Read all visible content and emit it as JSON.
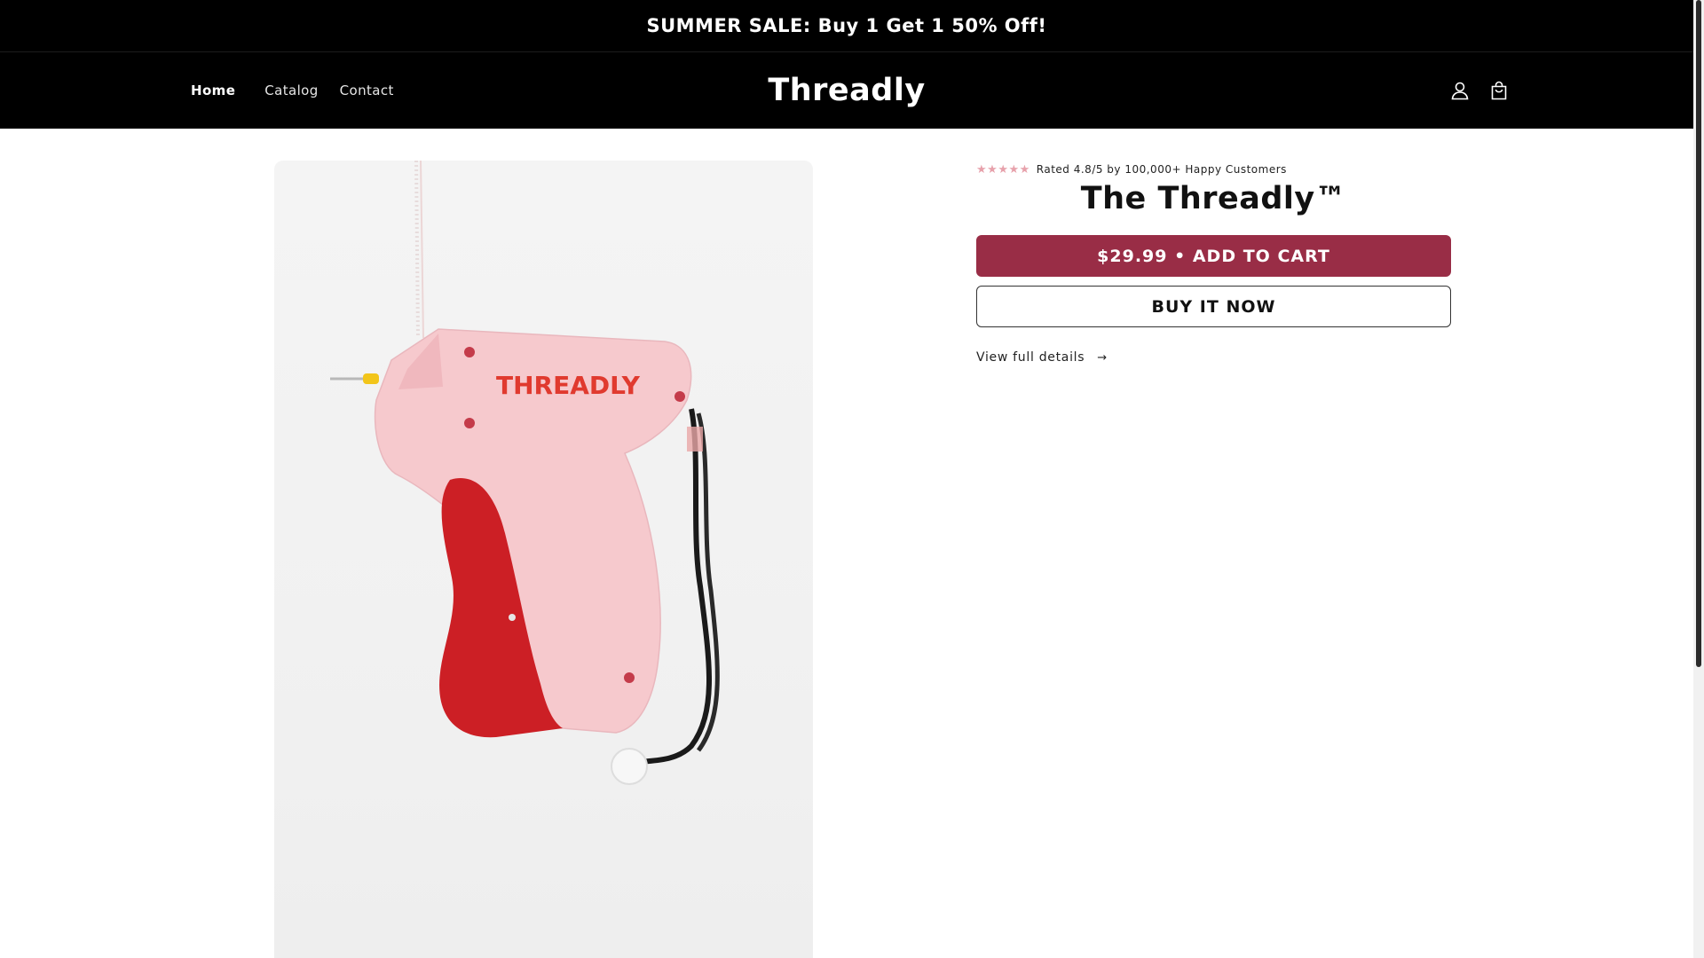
{
  "announcement": {
    "text": "SUMMER SALE: Buy 1 Get 1 50% Off!"
  },
  "header": {
    "nav": [
      {
        "label": "Home",
        "active": true
      },
      {
        "label": "Catalog",
        "active": false
      },
      {
        "label": "Contact",
        "active": false
      }
    ],
    "logo": "Threadly",
    "icons": [
      "account-icon",
      "cart-icon"
    ]
  },
  "product": {
    "image_brand_text": "THREADLY",
    "rating": {
      "stars": 5,
      "text": "Rated 4.8/5 by 100,000+ Happy Customers"
    },
    "title": "The Threadly™",
    "add_to_cart_label": "$29.99 • ADD TO CART",
    "buy_now_label": "BUY IT NOW",
    "details_link_label": "View full details",
    "details_arrow": "→"
  },
  "colors": {
    "header_bg": "#000000",
    "accent": "#992d46",
    "star": "#e7a1ab",
    "product_pink": "#f6c9cd",
    "product_red": "#cc1f25"
  }
}
